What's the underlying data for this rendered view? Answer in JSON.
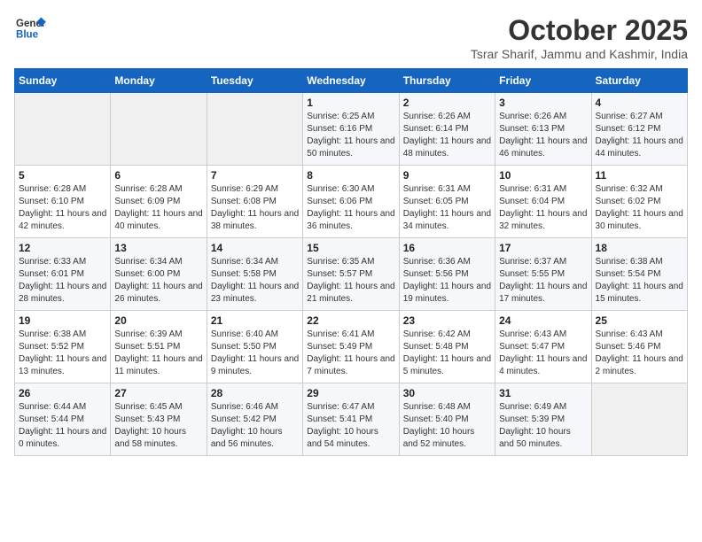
{
  "header": {
    "logo_line1": "General",
    "logo_line2": "Blue",
    "month_title": "October 2025",
    "subtitle": "Tsrar Sharif, Jammu and Kashmir, India"
  },
  "weekdays": [
    "Sunday",
    "Monday",
    "Tuesday",
    "Wednesday",
    "Thursday",
    "Friday",
    "Saturday"
  ],
  "weeks": [
    [
      {
        "day": "",
        "info": ""
      },
      {
        "day": "",
        "info": ""
      },
      {
        "day": "",
        "info": ""
      },
      {
        "day": "1",
        "info": "Sunrise: 6:25 AM\nSunset: 6:16 PM\nDaylight: 11 hours and 50 minutes."
      },
      {
        "day": "2",
        "info": "Sunrise: 6:26 AM\nSunset: 6:14 PM\nDaylight: 11 hours and 48 minutes."
      },
      {
        "day": "3",
        "info": "Sunrise: 6:26 AM\nSunset: 6:13 PM\nDaylight: 11 hours and 46 minutes."
      },
      {
        "day": "4",
        "info": "Sunrise: 6:27 AM\nSunset: 6:12 PM\nDaylight: 11 hours and 44 minutes."
      }
    ],
    [
      {
        "day": "5",
        "info": "Sunrise: 6:28 AM\nSunset: 6:10 PM\nDaylight: 11 hours and 42 minutes."
      },
      {
        "day": "6",
        "info": "Sunrise: 6:28 AM\nSunset: 6:09 PM\nDaylight: 11 hours and 40 minutes."
      },
      {
        "day": "7",
        "info": "Sunrise: 6:29 AM\nSunset: 6:08 PM\nDaylight: 11 hours and 38 minutes."
      },
      {
        "day": "8",
        "info": "Sunrise: 6:30 AM\nSunset: 6:06 PM\nDaylight: 11 hours and 36 minutes."
      },
      {
        "day": "9",
        "info": "Sunrise: 6:31 AM\nSunset: 6:05 PM\nDaylight: 11 hours and 34 minutes."
      },
      {
        "day": "10",
        "info": "Sunrise: 6:31 AM\nSunset: 6:04 PM\nDaylight: 11 hours and 32 minutes."
      },
      {
        "day": "11",
        "info": "Sunrise: 6:32 AM\nSunset: 6:02 PM\nDaylight: 11 hours and 30 minutes."
      }
    ],
    [
      {
        "day": "12",
        "info": "Sunrise: 6:33 AM\nSunset: 6:01 PM\nDaylight: 11 hours and 28 minutes."
      },
      {
        "day": "13",
        "info": "Sunrise: 6:34 AM\nSunset: 6:00 PM\nDaylight: 11 hours and 26 minutes."
      },
      {
        "day": "14",
        "info": "Sunrise: 6:34 AM\nSunset: 5:58 PM\nDaylight: 11 hours and 23 minutes."
      },
      {
        "day": "15",
        "info": "Sunrise: 6:35 AM\nSunset: 5:57 PM\nDaylight: 11 hours and 21 minutes."
      },
      {
        "day": "16",
        "info": "Sunrise: 6:36 AM\nSunset: 5:56 PM\nDaylight: 11 hours and 19 minutes."
      },
      {
        "day": "17",
        "info": "Sunrise: 6:37 AM\nSunset: 5:55 PM\nDaylight: 11 hours and 17 minutes."
      },
      {
        "day": "18",
        "info": "Sunrise: 6:38 AM\nSunset: 5:54 PM\nDaylight: 11 hours and 15 minutes."
      }
    ],
    [
      {
        "day": "19",
        "info": "Sunrise: 6:38 AM\nSunset: 5:52 PM\nDaylight: 11 hours and 13 minutes."
      },
      {
        "day": "20",
        "info": "Sunrise: 6:39 AM\nSunset: 5:51 PM\nDaylight: 11 hours and 11 minutes."
      },
      {
        "day": "21",
        "info": "Sunrise: 6:40 AM\nSunset: 5:50 PM\nDaylight: 11 hours and 9 minutes."
      },
      {
        "day": "22",
        "info": "Sunrise: 6:41 AM\nSunset: 5:49 PM\nDaylight: 11 hours and 7 minutes."
      },
      {
        "day": "23",
        "info": "Sunrise: 6:42 AM\nSunset: 5:48 PM\nDaylight: 11 hours and 5 minutes."
      },
      {
        "day": "24",
        "info": "Sunrise: 6:43 AM\nSunset: 5:47 PM\nDaylight: 11 hours and 4 minutes."
      },
      {
        "day": "25",
        "info": "Sunrise: 6:43 AM\nSunset: 5:46 PM\nDaylight: 11 hours and 2 minutes."
      }
    ],
    [
      {
        "day": "26",
        "info": "Sunrise: 6:44 AM\nSunset: 5:44 PM\nDaylight: 11 hours and 0 minutes."
      },
      {
        "day": "27",
        "info": "Sunrise: 6:45 AM\nSunset: 5:43 PM\nDaylight: 10 hours and 58 minutes."
      },
      {
        "day": "28",
        "info": "Sunrise: 6:46 AM\nSunset: 5:42 PM\nDaylight: 10 hours and 56 minutes."
      },
      {
        "day": "29",
        "info": "Sunrise: 6:47 AM\nSunset: 5:41 PM\nDaylight: 10 hours and 54 minutes."
      },
      {
        "day": "30",
        "info": "Sunrise: 6:48 AM\nSunset: 5:40 PM\nDaylight: 10 hours and 52 minutes."
      },
      {
        "day": "31",
        "info": "Sunrise: 6:49 AM\nSunset: 5:39 PM\nDaylight: 10 hours and 50 minutes."
      },
      {
        "day": "",
        "info": ""
      }
    ]
  ]
}
